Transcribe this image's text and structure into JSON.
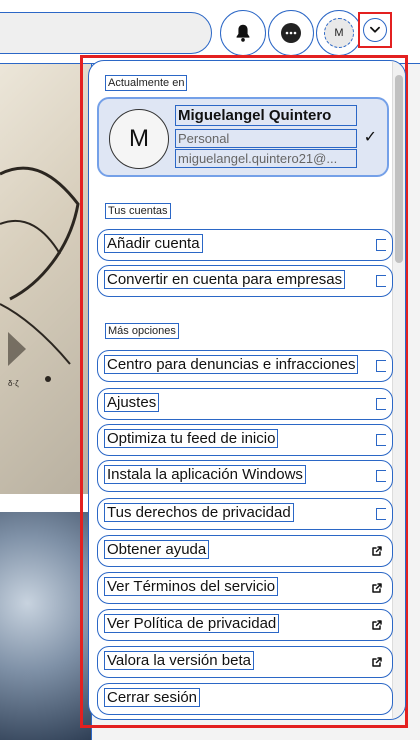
{
  "header": {
    "avatar_initial": "M",
    "icons": [
      "bell-icon",
      "chat-icon",
      "avatar",
      "chevron-down-icon"
    ]
  },
  "account": {
    "section_current": "Actualmente en",
    "avatar_initial": "M",
    "name": "Miguelangel Quintero",
    "type": "Personal",
    "email": "miguelangel.quintero21@..."
  },
  "accounts": {
    "section_title": "Tus cuentas",
    "items": [
      {
        "label": "Añadir cuenta"
      },
      {
        "label": "Convertir en cuenta para empresas"
      }
    ]
  },
  "more": {
    "section_title": "Más opciones",
    "items": [
      {
        "label": "Centro para denuncias e infracciones",
        "external": false
      },
      {
        "label": "Ajustes",
        "external": false
      },
      {
        "label": "Optimiza tu feed de inicio",
        "external": false
      },
      {
        "label": "Instala la aplicación Windows",
        "external": false
      },
      {
        "label": "Tus derechos de privacidad",
        "external": false
      },
      {
        "label": "Obtener ayuda",
        "external": true
      },
      {
        "label": "Ver Términos del servicio",
        "external": true
      },
      {
        "label": "Ver Política de privacidad",
        "external": true
      },
      {
        "label": "Valora la versión beta",
        "external": true
      },
      {
        "label": "Cerrar sesión",
        "external": false
      }
    ]
  },
  "colors": {
    "accent": "#2b67c6",
    "highlight": "#e32020",
    "selected_bg": "#dfe6f4"
  }
}
